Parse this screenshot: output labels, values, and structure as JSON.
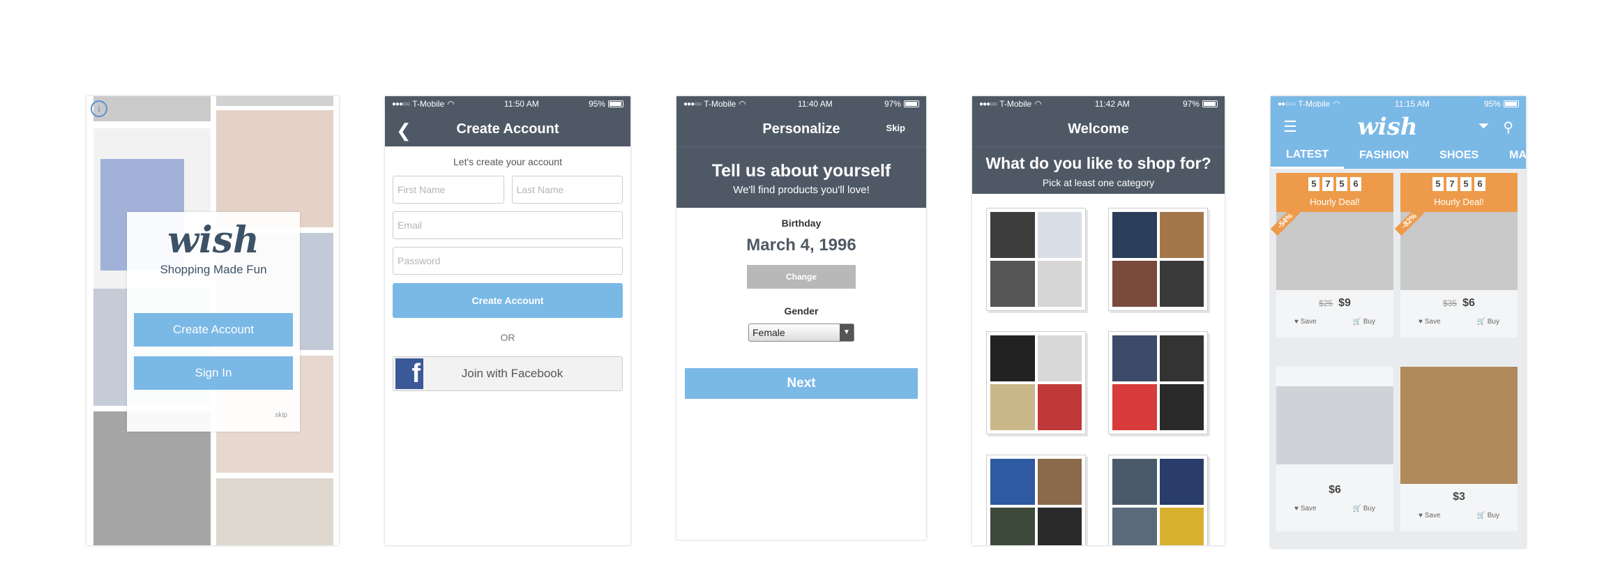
{
  "status": {
    "p2": {
      "carrier": "T-Mobile",
      "time": "11:50 AM",
      "battery": "95%"
    },
    "p3": {
      "carrier": "T-Mobile",
      "time": "11:40 AM",
      "battery": "97%"
    },
    "p4": {
      "carrier": "T-Mobile",
      "time": "11:42 AM",
      "battery": "97%"
    },
    "p5": {
      "carrier": "T-Mobile",
      "time": "11:15 AM",
      "battery": "95%"
    }
  },
  "splash": {
    "logo": "wish",
    "tagline": "Shopping Made Fun",
    "create_label": "Create Account",
    "signin_label": "Sign In",
    "skip_label": "skip"
  },
  "create": {
    "title": "Create Account",
    "subtitle": "Let's create your account",
    "first_name_placeholder": "First Name",
    "last_name_placeholder": "Last Name",
    "email_placeholder": "Email",
    "password_placeholder": "Password",
    "submit_label": "Create Account",
    "or_label": "OR",
    "facebook_label": "Join with Facebook"
  },
  "personalize": {
    "title": "Personalize",
    "skip_label": "Skip",
    "heading": "Tell us about yourself",
    "subheading": "We'll find products you'll love!",
    "birthday_label": "Birthday",
    "birthday_value": "March 4, 1996",
    "change_label": "Change",
    "gender_label": "Gender",
    "gender_value": "Female",
    "next_label": "Next"
  },
  "welcome": {
    "title": "Welcome",
    "heading": "What do you like to shop for?",
    "subheading": "Pick at least one category"
  },
  "feed": {
    "logo": "wish",
    "tabs": [
      "LATEST",
      "FASHION",
      "SHOES",
      "MA"
    ],
    "products": [
      {
        "timer": [
          "5",
          "7",
          "5",
          "6"
        ],
        "badge": "Hourly Deal!",
        "discount": "-54%",
        "old_price": "$25",
        "price": "$9"
      },
      {
        "timer": [
          "5",
          "7",
          "5",
          "6"
        ],
        "badge": "Hourly Deal!",
        "discount": "-82%",
        "old_price": "$35",
        "price": "$6"
      },
      {
        "price": "$6"
      },
      {
        "price": "$3"
      }
    ],
    "save_label": "Save",
    "buy_label": "Buy"
  }
}
